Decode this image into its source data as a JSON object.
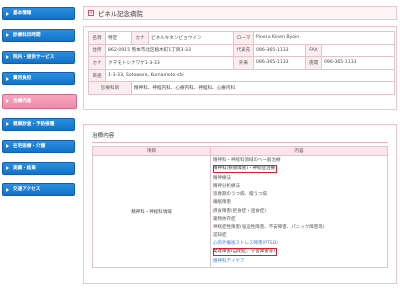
{
  "sidebar": {
    "items": [
      {
        "label": "基本情報"
      },
      {
        "label": "診療科目時間"
      },
      {
        "label": "院内・提供サービス"
      },
      {
        "label": "費用負担"
      },
      {
        "label": "治療内容"
      },
      {
        "label": "健康診査・予防接種"
      },
      {
        "label": "在宅医療・介護"
      },
      {
        "label": "実績・結果"
      },
      {
        "label": "交通アクセス"
      }
    ]
  },
  "header": {
    "icon": "plus-box-icon",
    "title": "ピネル記念病院"
  },
  "info": {
    "name_label": "名称",
    "name": "特定",
    "kana_label": "カナ",
    "kana": "ピネルキネンビョウイン",
    "roman_label": "ローマ",
    "roman": "Pineru Kinen Byoin",
    "addr_label": "住所",
    "addr": "862-0915  熊本市北区植木町1丁目3-33",
    "rep_label": "代表先",
    "rep": "096-365-1133",
    "fax_label": "FAX",
    "fax": "",
    "kana2_label": "カナ",
    "kana2": "クマモトシナワゲ1-3-33",
    "ref_label": "外来",
    "ref": "096-365-1133",
    "night_label": "夜間",
    "night": "096-365-1133",
    "eng_label": "英語",
    "eng": "1-3-33, Sotowara, Kumamoto-shi",
    "dept_label": "診療科目",
    "dept": "精神科、神経内科、心療内科、神経科、心療内科"
  },
  "treatment": {
    "title": "治療内容",
    "col_item": "項目",
    "col_content": "内容",
    "category": "精神科・神経科領域",
    "items": [
      {
        "text": "精神科・神経科領域のへ一般治療",
        "hl": false,
        "blue": false
      },
      {
        "text": "精神科(摂食障害)・神経症治療",
        "hl": true,
        "blue": false
      },
      {
        "text": "精神療法",
        "hl": false,
        "blue": false
      },
      {
        "text": "精神分析療法",
        "hl": false,
        "blue": false
      },
      {
        "text": "思春期のうつ病、躁うつ病",
        "hl": false,
        "blue": false
      },
      {
        "text": "睡眠障害",
        "hl": false,
        "blue": false
      },
      {
        "text": "摂食障害(拒食症・過食症)",
        "hl": false,
        "blue": false
      },
      {
        "text": "薬物依存症",
        "hl": false,
        "blue": false
      },
      {
        "text": "神経症性障害(強迫性障害、不安障害、パニック障害等)",
        "hl": false,
        "blue": false
      },
      {
        "text": "認知症",
        "hl": false,
        "blue": false
      },
      {
        "text": "心的外傷後ストレス障害(PTSD)",
        "hl": false,
        "blue": true
      },
      {
        "text": "発達障害(自閉症、学習障害等)",
        "hl": true,
        "blue": false
      },
      {
        "text": "精神科デイケア",
        "hl": false,
        "blue": true
      }
    ]
  },
  "colors": {
    "nav": "#1a7bd0",
    "nav_active": "#f19ab4",
    "border_pink": "#f1c5cf",
    "highlight": "#d8202a"
  }
}
